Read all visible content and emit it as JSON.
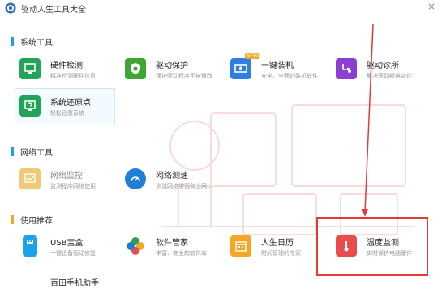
{
  "window": {
    "title": "驱动人生工具大全",
    "close_glyph": "×"
  },
  "accent": {
    "section_bar": "#1aa3e8",
    "section_bar_orange": "#f5a623",
    "highlight_red": "#e53935"
  },
  "sections": [
    {
      "title": "系统工具"
    },
    {
      "title": "网络工具"
    },
    {
      "title": "使用推荐"
    }
  ],
  "tools": {
    "hardware_check": {
      "name": "硬件检测",
      "desc": "精准检测硬件信息",
      "icon": "monitor-icon",
      "color": "#22a35a"
    },
    "driver_protect": {
      "name": "驱动保护",
      "desc": "保护驱动程序不被覆改",
      "icon": "shield-icon",
      "color": "#3fa535"
    },
    "one_click_install": {
      "name": "一键装机",
      "desc": "安全、全面的装机软件",
      "icon": "pc-install-icon",
      "color": "#2f7fe0",
      "badge": "NEW"
    },
    "driver_clinic": {
      "name": "驱动诊所",
      "desc": "解决驱动疑难杂症",
      "icon": "stethoscope-icon",
      "color": "#8a3fd1"
    },
    "system_restore": {
      "name": "系统还原点",
      "desc": "轻松还原系统",
      "icon": "restore-icon",
      "color": "#22a35a"
    },
    "network_monitor": {
      "name": "网络监控",
      "desc": "监测程序网络使用",
      "icon": "chart-icon",
      "color": "#f0c878"
    },
    "network_speed": {
      "name": "网络测速",
      "desc": "测试网络带宽和上网...",
      "icon": "speedometer-icon",
      "color": "#1f7fd6"
    },
    "usb_box": {
      "name": "USB宝盒",
      "desc": "一键设备驱动修复",
      "icon": "usb-icon",
      "color": "#1aa3e8"
    },
    "software_manager": {
      "name": "软件管家",
      "desc": "丰富、安全的软件库",
      "icon": "petals-icon",
      "color": "#ffffff"
    },
    "calendar": {
      "name": "人生日历",
      "desc": "时间管理的专家",
      "icon": "calendar-icon",
      "color": "#f5a623"
    },
    "temperature": {
      "name": "温度监测",
      "desc": "实时保护电脑硬件",
      "icon": "thermometer-icon",
      "color": "#e84c4c"
    },
    "phone_helper": {
      "name": "百田手机助手"
    }
  }
}
